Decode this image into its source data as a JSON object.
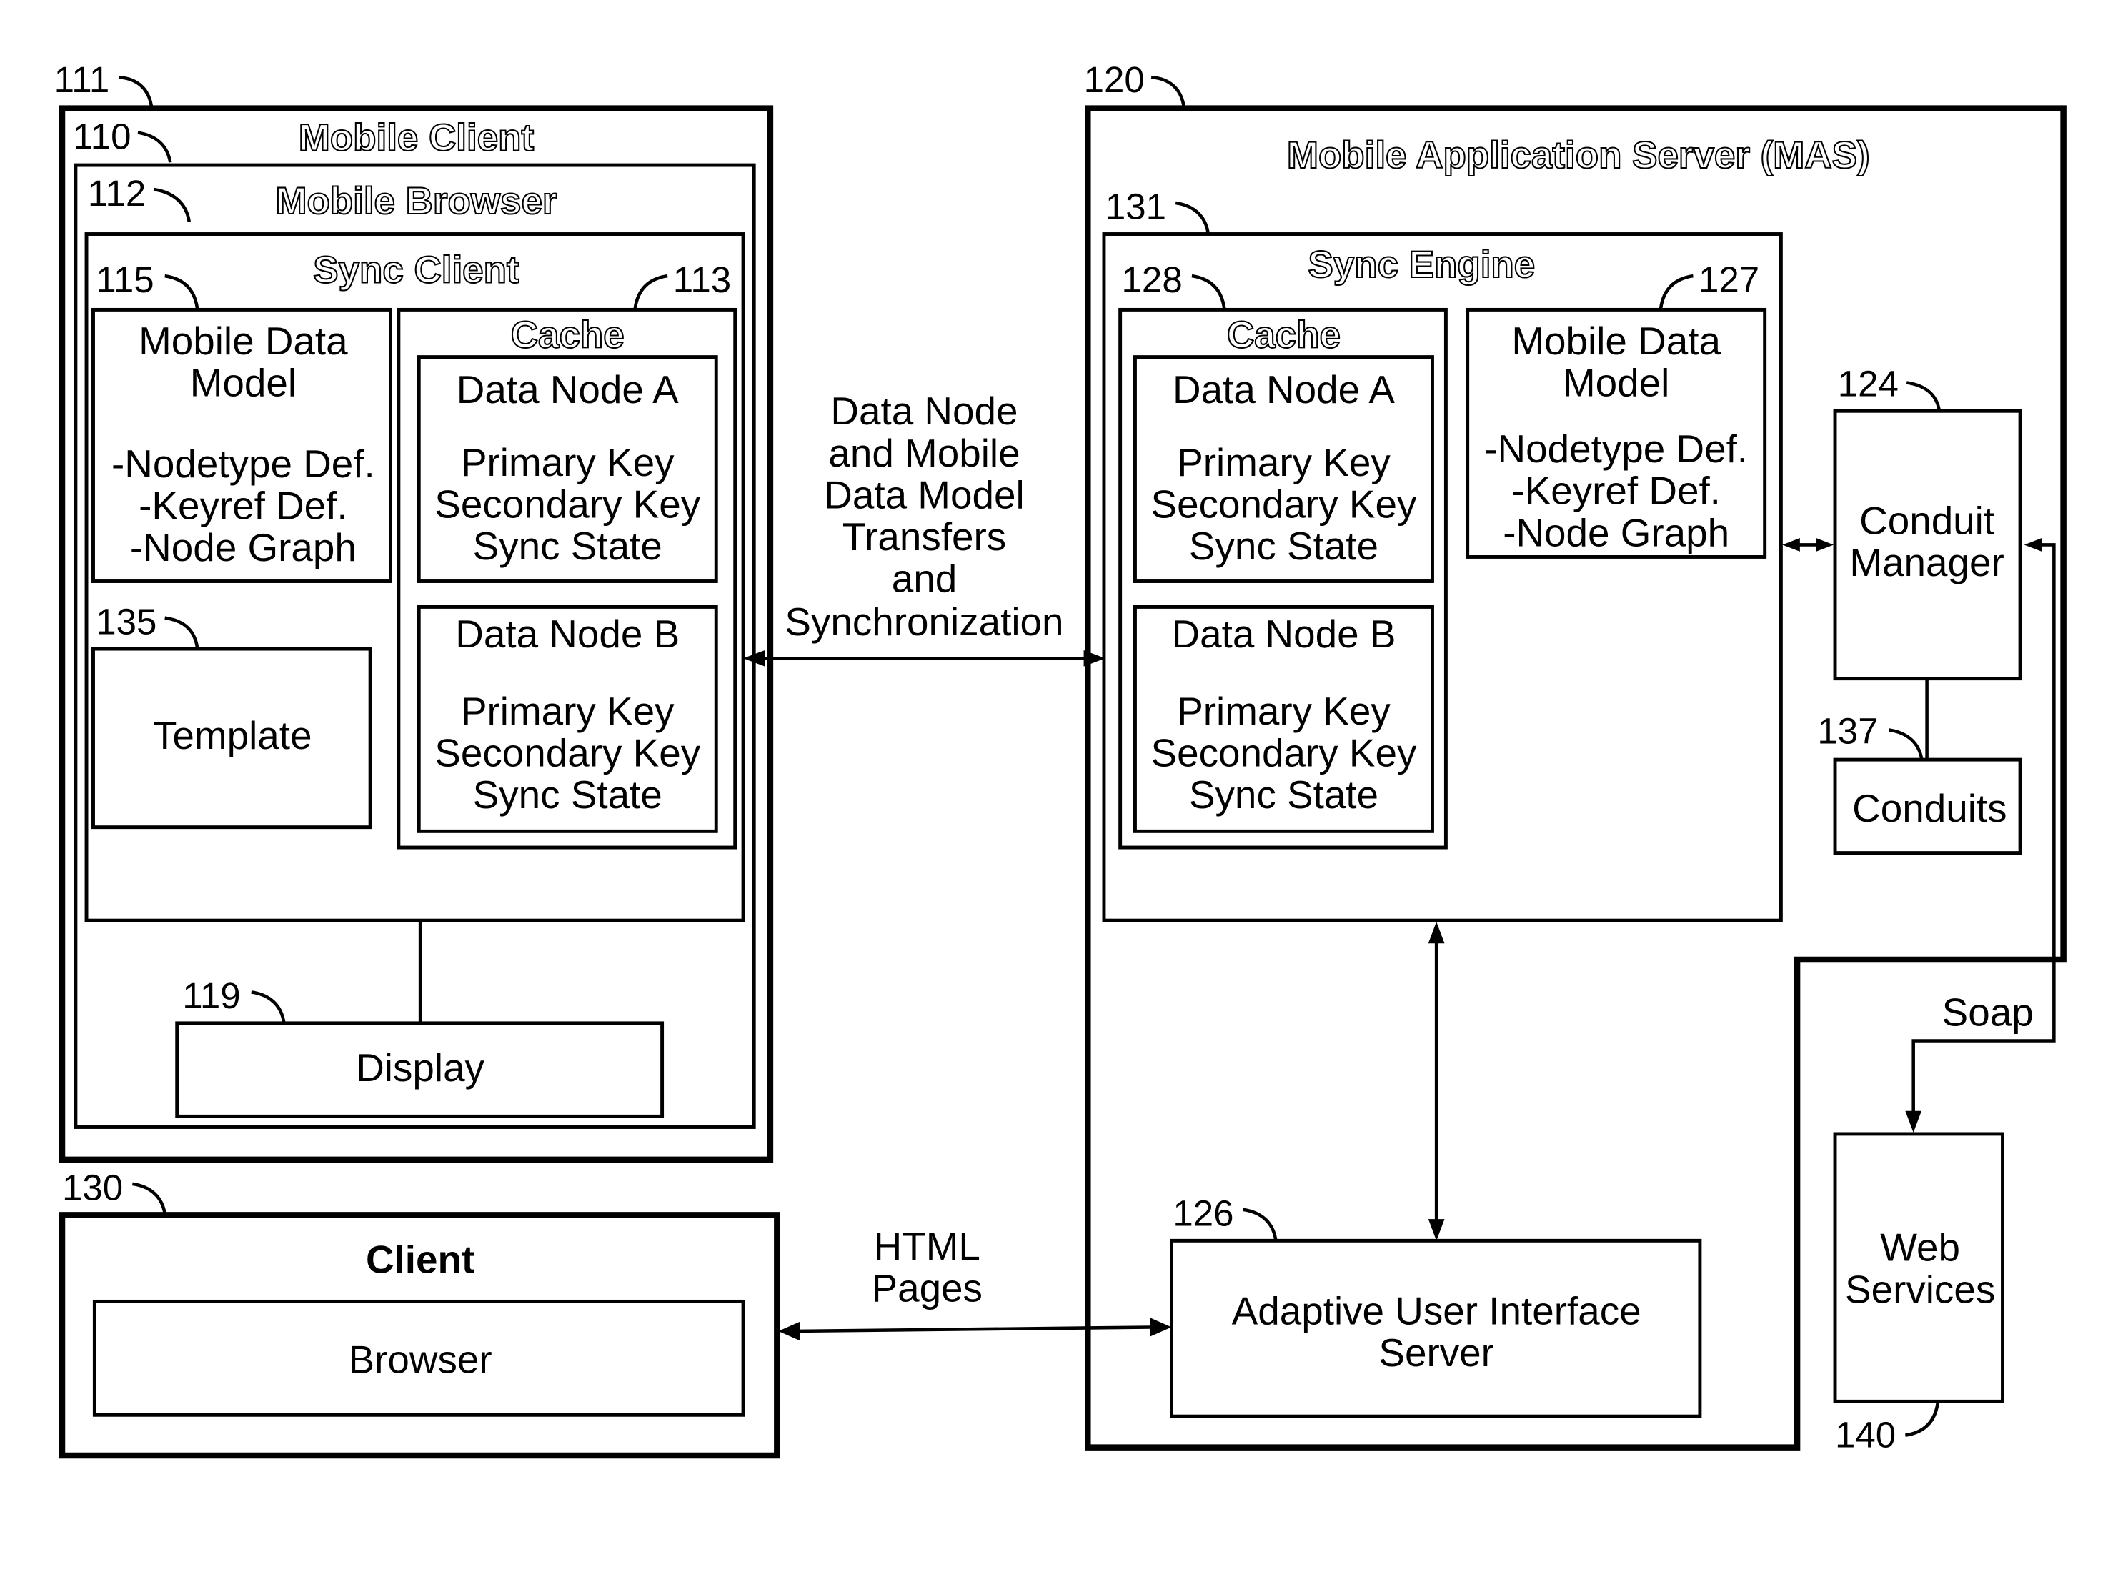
{
  "diagram": {
    "mobile_client": {
      "ref": "111",
      "title": "Mobile Client",
      "inner_ref": "110",
      "browser": {
        "ref": "112",
        "title": "Mobile Browser",
        "sync_client": {
          "title": "Sync Client",
          "mobile_data_model": {
            "ref": "115",
            "lines": [
              "Mobile Data",
              "Model",
              "-Nodetype Def.",
              "-Keyref Def.",
              "-Node Graph"
            ]
          },
          "cache": {
            "ref": "113",
            "title": "Cache",
            "nodes": [
              {
                "lines": [
                  "Data Node A",
                  "Primary Key",
                  "Secondary Key",
                  "Sync State"
                ]
              },
              {
                "lines": [
                  "Data Node B",
                  "Primary Key",
                  "Secondary Key",
                  "Sync State"
                ]
              }
            ]
          },
          "template": {
            "ref": "135",
            "label": "Template"
          }
        },
        "display": {
          "ref": "119",
          "label": "Display"
        }
      }
    },
    "client": {
      "ref": "130",
      "title": "Client",
      "browser_label": "Browser"
    },
    "transfer_label": [
      "Data Node",
      "and Mobile",
      "Data Model",
      "Transfers",
      "and",
      "Synchronization"
    ],
    "html_pages_label": [
      "HTML",
      "Pages"
    ],
    "mas": {
      "ref": "120",
      "title": "Mobile Application Server (MAS)",
      "sync_engine": {
        "ref": "131",
        "title": "Sync Engine",
        "cache": {
          "ref": "128",
          "title": "Cache",
          "nodes": [
            {
              "lines": [
                "Data Node A",
                "Primary Key",
                "Secondary Key",
                "Sync State"
              ]
            },
            {
              "lines": [
                "Data Node B",
                "Primary Key",
                "Secondary Key",
                "Sync State"
              ]
            }
          ]
        },
        "mobile_data_model": {
          "ref": "127",
          "lines": [
            "Mobile Data",
            "Model",
            "-Nodetype Def.",
            "-Keyref Def.",
            "-Node Graph"
          ]
        }
      },
      "conduit_manager": {
        "ref": "124",
        "lines": [
          "Conduit",
          "Manager"
        ]
      },
      "conduits": {
        "ref": "137",
        "label": "Conduits"
      },
      "adaptive_ui_server": {
        "ref": "126",
        "lines": [
          "Adaptive User Interface",
          "Server"
        ]
      }
    },
    "soap_label": "Soap",
    "web_services": {
      "ref": "140",
      "lines": [
        "Web",
        "Services"
      ]
    }
  }
}
